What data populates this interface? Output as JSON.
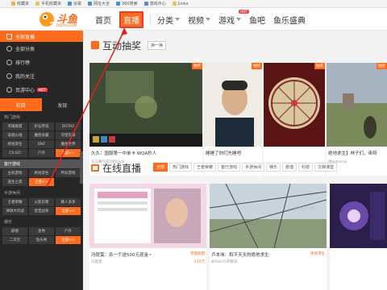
{
  "bookmarks": [
    "收藏夹",
    "手机收藏夹",
    "谷歌",
    "网址大全",
    "360搜索",
    "游戏中心",
    "Links"
  ],
  "nav": {
    "logo_text": "斗鱼",
    "logo_sub": "DOUYU.COM",
    "items": [
      "首页",
      "直播",
      "分类",
      "视频",
      "游戏",
      "鱼吧",
      "鱼乐盛典"
    ],
    "hot": "HOT"
  },
  "sidebar": {
    "items": [
      "全部直播",
      "全部分类",
      "排行榜",
      "我的关注",
      "页游中心"
    ],
    "tabs": [
      "栏目",
      "发现"
    ],
    "sections": [
      {
        "title": "热门游戏",
        "items": [
          "英雄联盟",
          "炉石传说",
          "DOTA2",
          "穿越火线",
          "魔兽争霸",
          "守望先锋",
          "绝地求生",
          "DNF",
          "魔兽世界",
          "CS:GO",
          "户外",
          "全部>>"
        ]
      },
      {
        "title": "客厅游戏",
        "items": [
          "主机游戏",
          "绝地求生",
          "怀旧游戏",
          "逃生之夜",
          "全部>>",
          ""
        ]
      },
      {
        "title": "手游休闲",
        "items": [
          "王者荣耀",
          "火影忍者",
          "跳人多多",
          "球球大作战",
          "皇室战争",
          "全部>>"
        ]
      },
      {
        "title": "娱乐",
        "items": [
          "颜值",
          "星秀",
          "户外",
          "二次元",
          "鱼乐秀",
          "全部>>"
        ]
      }
    ]
  },
  "lottery": {
    "title": "互动抽奖",
    "swap": "换一换",
    "tag": "抽奖",
    "cards": [
      {
        "title": "久久：国服第一中单卡 WQA秒人",
        "sub": "久久舞气成功的OvO",
        "cat": ""
      },
      {
        "title": "睡睡了你们先睡吧",
        "sub": "",
        "cat": ""
      },
      {
        "title": "",
        "sub": "",
        "cat": ""
      },
      {
        "title": "绝地求生】林子们，来呀",
        "sub": "帅aIstrong",
        "cat": ""
      }
    ]
  },
  "live": {
    "title": "在线直播",
    "filters": [
      "全部",
      "热门游戏",
      "王者荣耀",
      "客厅游戏",
      "手游休闲",
      "娱乐",
      "颜值",
      "科技",
      "文娱课堂"
    ],
    "cards": [
      {
        "title": "冯提莫：杀一个送500元现金~",
        "sub": "冯提莫",
        "cat": "英雄联盟",
        "views": "210万"
      },
      {
        "title": "卢本伟：和平天天的绝地求生",
        "sub": "White55开解说",
        "cat": "绝地求生",
        "views": ""
      },
      {
        "title": "",
        "sub": "",
        "cat": "",
        "views": ""
      }
    ]
  },
  "watermark": "jingyan"
}
